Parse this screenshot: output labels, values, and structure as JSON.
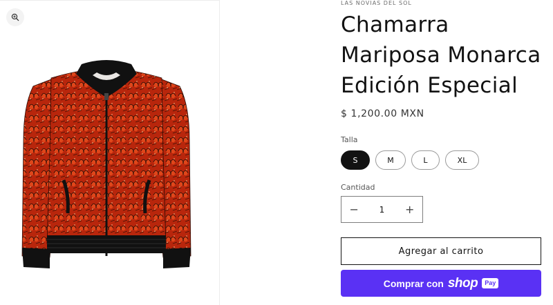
{
  "product": {
    "vendor": "LAS NOVIAS DEL SOL",
    "title": "Chamarra Mariposa Monarca Edición Especial",
    "price": "$ 1,200.00 MXN"
  },
  "media": {
    "zoom_icon": "zoom-in-icon"
  },
  "variants": {
    "label": "Talla",
    "options": [
      "S",
      "M",
      "L",
      "XL"
    ],
    "selected": "S"
  },
  "quantity": {
    "label": "Cantidad",
    "value": "1",
    "minus": "−",
    "plus": "+"
  },
  "buttons": {
    "add_to_cart": "Agregar al carrito",
    "shop_pay_prefix": "Comprar con",
    "shop_word": "shop",
    "pay_word": "Pay"
  },
  "colors": {
    "accent": "#5a31f4",
    "selected_pill": "#121212",
    "jacket_base": "#c0290f",
    "jacket_trim": "#111111"
  }
}
